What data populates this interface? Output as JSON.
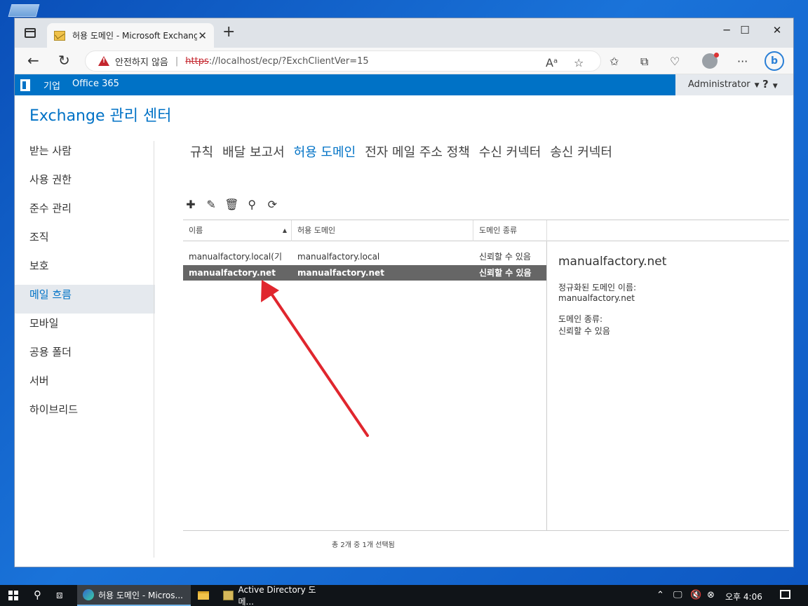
{
  "browser": {
    "tab_title": "허용 도메인 - Microsoft Exchange",
    "tab_close": "✕",
    "new_tab": "+",
    "minimize": "─",
    "maximize": "☐",
    "close": "✕",
    "security_warning": "안전하지 않음",
    "url_scheme": "https",
    "url_rest": "://localhost/ecp/?ExchClientVer=15"
  },
  "o365bar": {
    "enterprise": "기업",
    "office365": "Office 365",
    "admin_name": "Administrator",
    "help": "?"
  },
  "ecp": {
    "title": "Exchange 관리 센터",
    "leftnav": [
      {
        "label": "받는 사람"
      },
      {
        "label": "사용 권한"
      },
      {
        "label": "준수 관리"
      },
      {
        "label": "조직"
      },
      {
        "label": "보호"
      },
      {
        "label": "메일 흐름",
        "active": true
      },
      {
        "label": "모바일"
      },
      {
        "label": "공용 폴더"
      },
      {
        "label": "서버"
      },
      {
        "label": "하이브리드"
      }
    ],
    "subtabs": [
      {
        "label": "규칙"
      },
      {
        "label": "배달 보고서"
      },
      {
        "label": "허용 도메인",
        "active": true
      },
      {
        "label": "전자 메일 주소 정책"
      },
      {
        "label": "수신 커넥터"
      },
      {
        "label": "송신 커넥터"
      }
    ],
    "columns": [
      "이름",
      "허용 도메인",
      "도메인 종류"
    ],
    "rows": [
      {
        "name": "manualfactory.local(기본값)",
        "domain": "manualfactory.local",
        "type": "신뢰할 수 있음",
        "selected": false
      },
      {
        "name": "manualfactory.net",
        "domain": "manualfactory.net",
        "type": "신뢰할 수 있음",
        "selected": true
      }
    ],
    "detail": {
      "title": "manualfactory.net",
      "label1": "정규화된 도메인 이름:",
      "value1": "manualfactory.net",
      "label2": "도메인 종류:",
      "value2": "신뢰할 수 있음"
    },
    "status": "총 2개 중 1개 선택됨"
  },
  "taskbar": {
    "task_edge": "허용 도메인 - Micros...",
    "task_ad": "Active Directory 도메...",
    "clock": "오후 4:06"
  },
  "colors": {
    "accent": "#0072c6",
    "annotation_arrow": "#e0262e"
  }
}
